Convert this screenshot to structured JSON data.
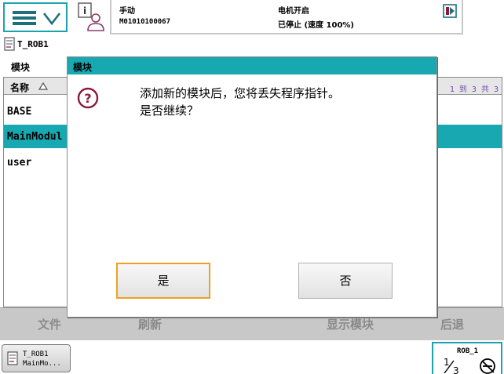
{
  "status": {
    "mode": "手动",
    "controller_id": "M01010100067",
    "motor_status": "电机开启",
    "run_status": "已停止 (速度 100%)"
  },
  "task": {
    "name": "T_ROB1"
  },
  "module_list": {
    "section_title": "模块",
    "column_name": "名称",
    "page_info": "1 到 3 共 3",
    "rows": [
      {
        "name": "BASE"
      },
      {
        "name": "MainModul"
      },
      {
        "name": "user"
      }
    ],
    "selected_index": 1
  },
  "toolbar": {
    "file_label": "文件",
    "refresh_label": "刷新",
    "show_module_label": "显示模块",
    "back_label": "后退"
  },
  "statusbar": {
    "task_button_line1": "T_ROB1",
    "task_button_line2": "MainMo...",
    "robot_label": "ROB_1",
    "fraction_label": "1/3"
  },
  "dialog": {
    "title": "模块",
    "message_line1": "添加新的模块后，您将丢失程序指针。",
    "message_line2": "是否继续？",
    "yes_label": "是",
    "no_label": "否"
  },
  "colors": {
    "accent": "#17a8b2",
    "focus": "#f0a020",
    "toolbar": "#c8c8c8",
    "page_info": "#6a4fb0"
  },
  "icons": [
    "menu-icon",
    "chevron-down-icon",
    "operator-info-icon",
    "status-icon",
    "task-program-icon",
    "sort-ascending-icon",
    "question-icon",
    "robot-speed-icon"
  ]
}
